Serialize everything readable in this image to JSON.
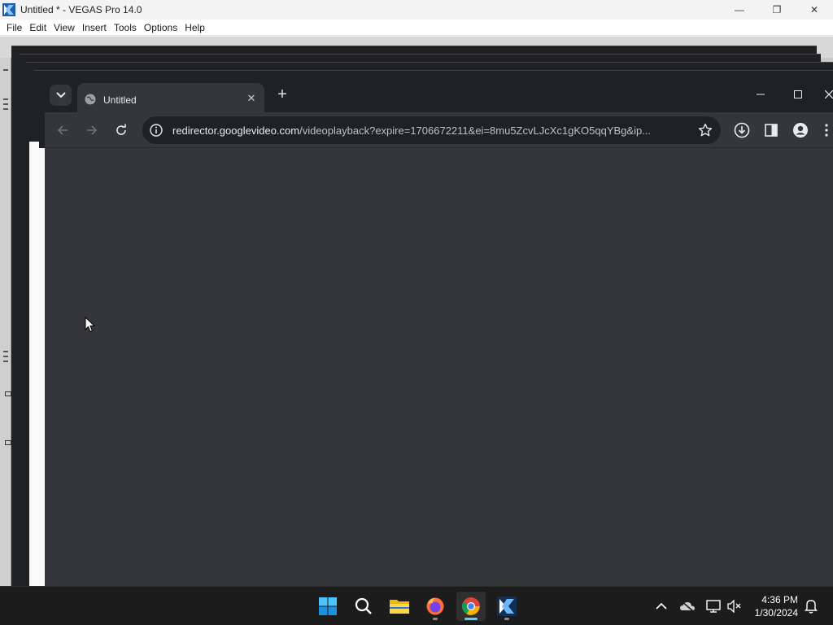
{
  "vegas": {
    "title": "Untitled * - VEGAS Pro 14.0",
    "menu": [
      "File",
      "Edit",
      "View",
      "Insert",
      "Tools",
      "Options",
      "Help"
    ],
    "controls": {
      "minimize": "—",
      "restore": "❐",
      "close": "✕"
    }
  },
  "chrome": {
    "tab": {
      "title": "Untitled",
      "close": "✕"
    },
    "new_tab": "+",
    "url_host": "redirector.googlevideo.com",
    "url_rest": "/videoplayback?expire=1706672211&ei=8mu5ZcvLJcXc1gKO5qqYBg&ip...",
    "icons": [
      "tab-search-icon",
      "globe-icon",
      "back-icon",
      "forward-icon",
      "reload-icon",
      "site-info-icon",
      "star-icon",
      "download-icon",
      "side-panel-icon",
      "profile-icon",
      "kebab-menu-icon"
    ]
  },
  "taskbar": {
    "apps": [
      "windows-start-icon",
      "search-icon",
      "file-explorer-icon",
      "firefox-icon",
      "chrome-icon",
      "vegas-pro-icon"
    ],
    "tray": [
      "chevron-up-icon",
      "onedrive-offline-icon",
      "network-icon",
      "volume-muted-icon",
      "notification-bell-icon"
    ],
    "time": "4:36 PM",
    "date": "1/30/2024"
  },
  "colors": {
    "chrome_frame": "#202124",
    "chrome_toolbar": "#35363a",
    "taskbar": "#1c1c1c",
    "accent": "#60cdff"
  }
}
